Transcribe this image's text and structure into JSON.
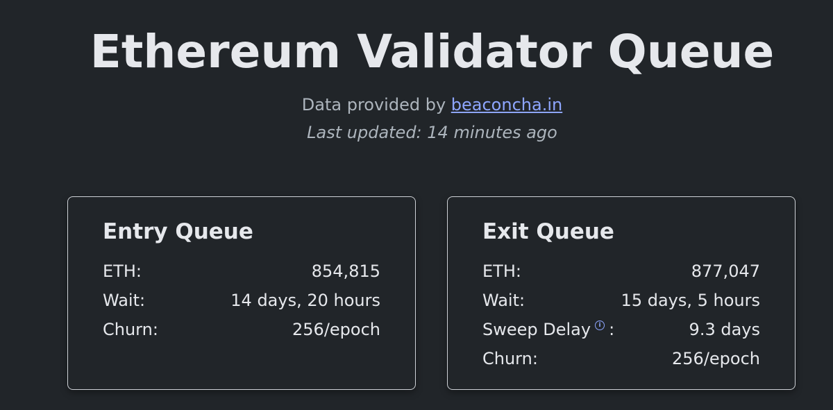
{
  "header": {
    "title": "Ethereum Validator Queue",
    "provided_prefix": "Data provided by ",
    "provided_link": "beaconcha.in",
    "last_updated": "Last updated: 14 minutes ago"
  },
  "entry_queue": {
    "title": "Entry Queue",
    "rows": [
      {
        "label": "ETH:",
        "value": "854,815"
      },
      {
        "label": "Wait:",
        "value": "14 days, 20 hours"
      },
      {
        "label": "Churn:",
        "value": "256/epoch"
      }
    ]
  },
  "exit_queue": {
    "title": "Exit Queue",
    "rows": [
      {
        "label": "ETH:",
        "value": "877,047"
      },
      {
        "label": "Wait:",
        "value": "15 days, 5 hours"
      },
      {
        "label": "Sweep Delay",
        "label_suffix": ":",
        "value": "9.3 days"
      },
      {
        "label": "Churn:",
        "value": "256/epoch"
      }
    ]
  },
  "icons": {
    "info_icon_glyph": "i",
    "info_icon_color": "#8ea6ff"
  },
  "colors": {
    "background": "#212529",
    "text": "#e6e8ec",
    "muted": "#adb5bd",
    "link": "#8ea6ff"
  }
}
